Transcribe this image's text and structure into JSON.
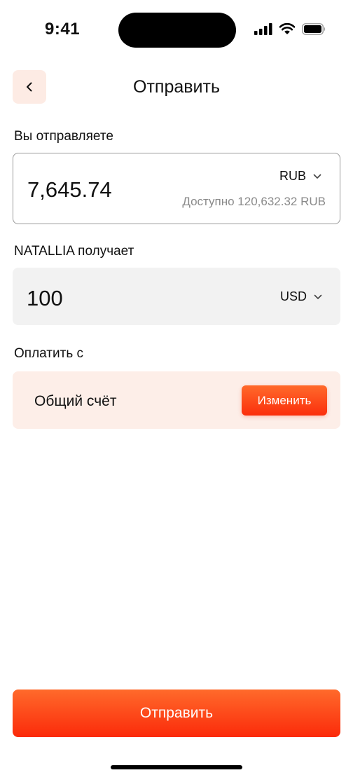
{
  "status_bar": {
    "time": "9:41"
  },
  "nav": {
    "title": "Отправить"
  },
  "send": {
    "label": "Вы отправляете",
    "amount": "7,645.74",
    "currency": "RUB",
    "available": "Доступно 120,632.32 RUB"
  },
  "receive": {
    "label": "NATALLIA получает",
    "amount": "100",
    "currency": "USD"
  },
  "pay_from": {
    "label": "Оплатить с",
    "account": "Общий счёт",
    "change_label": "Изменить"
  },
  "submit": {
    "label": "Отправить"
  },
  "colors": {
    "accent": "#fb3d14",
    "accent_light": "#fdeee8",
    "field_gray": "#f2f2f2",
    "muted_text": "#8a8a8a"
  }
}
